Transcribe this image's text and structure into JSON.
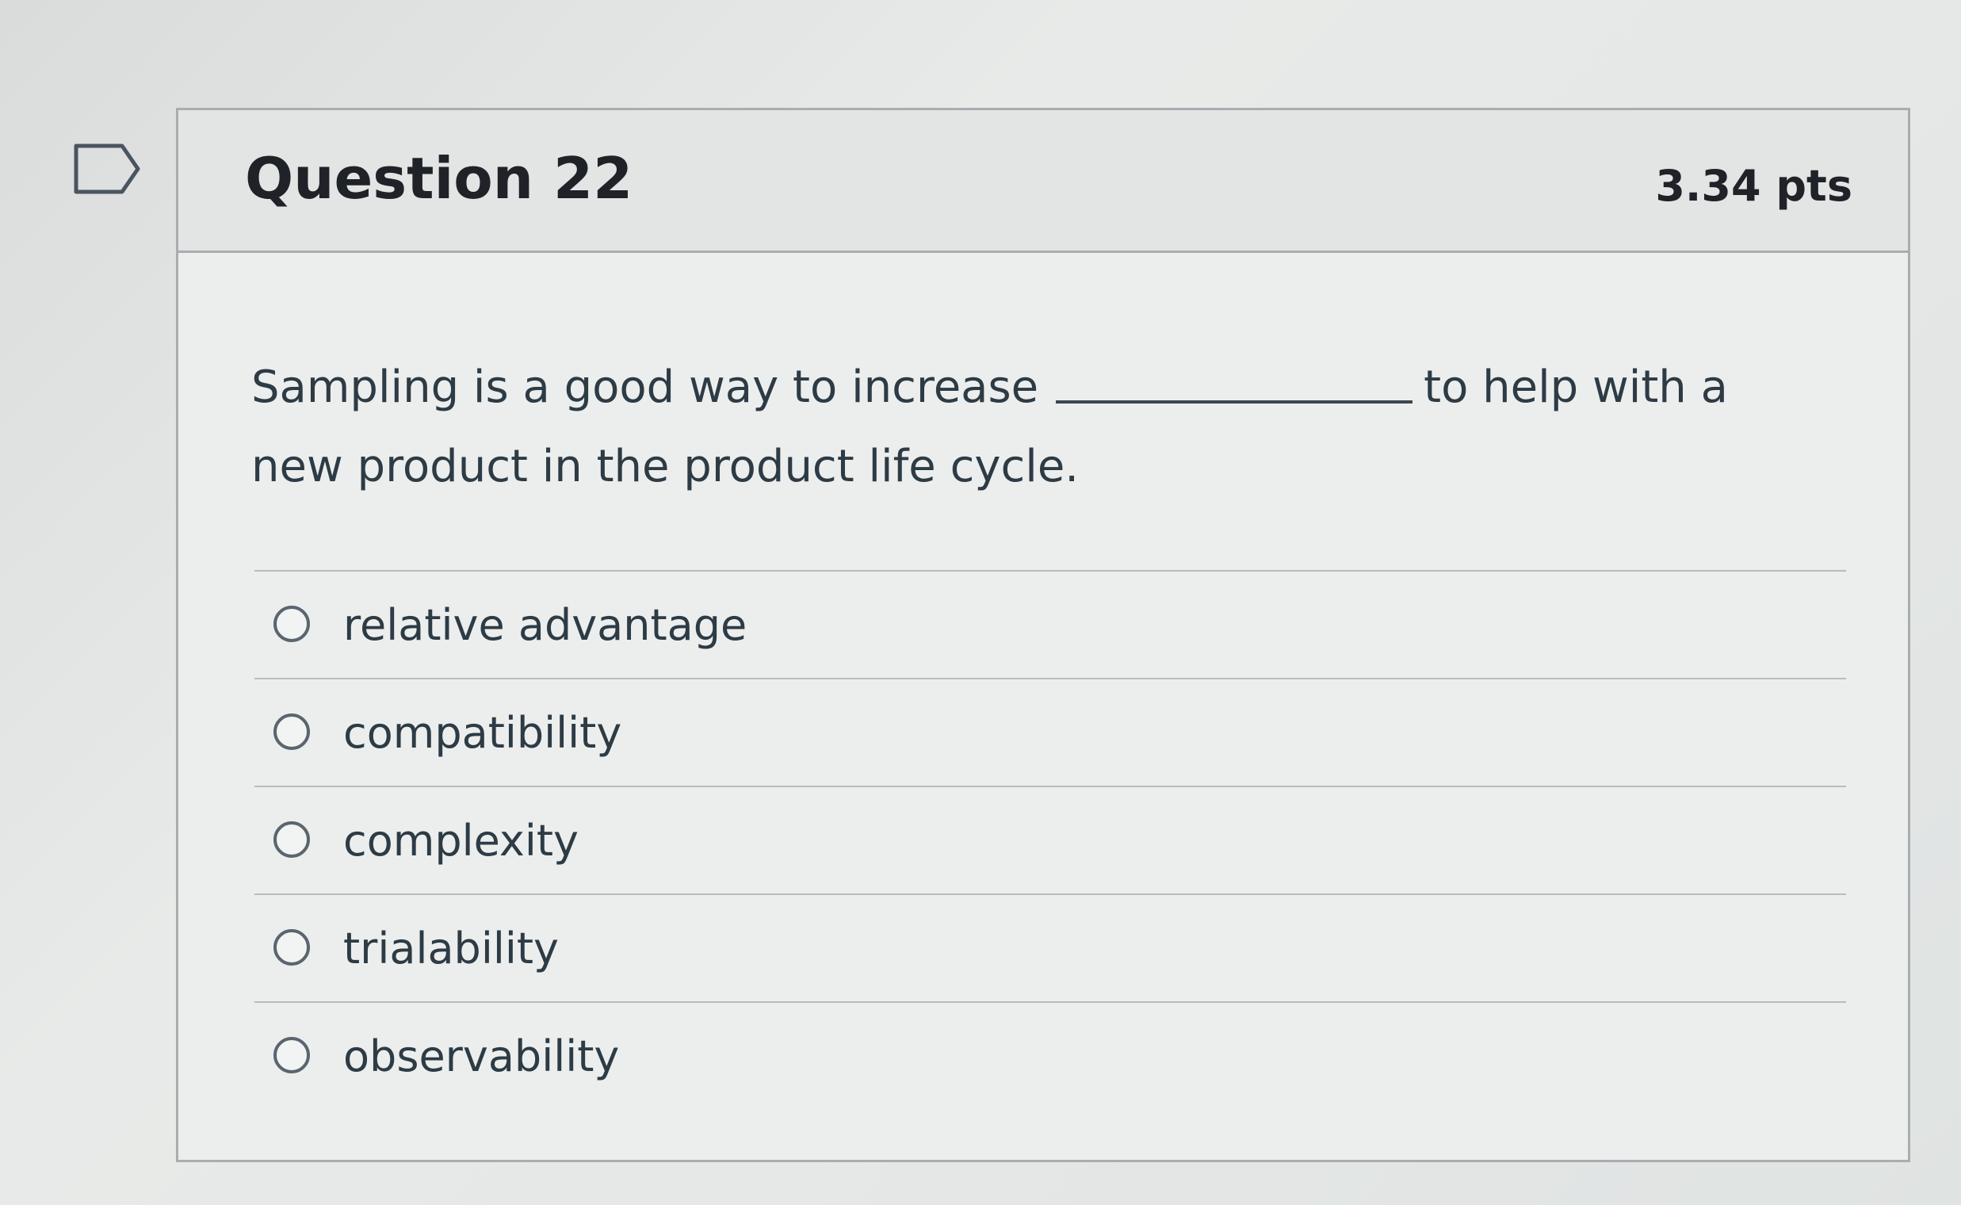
{
  "question": {
    "title": "Question 22",
    "points": "3.34 pts",
    "text_before_blank": "Sampling is a good way to increase",
    "text_after_blank": "to help with a new product in the product life cycle."
  },
  "answers": [
    {
      "label": "relative advantage"
    },
    {
      "label": "compatibility"
    },
    {
      "label": "complexity"
    },
    {
      "label": "trialability"
    },
    {
      "label": "observability"
    }
  ]
}
